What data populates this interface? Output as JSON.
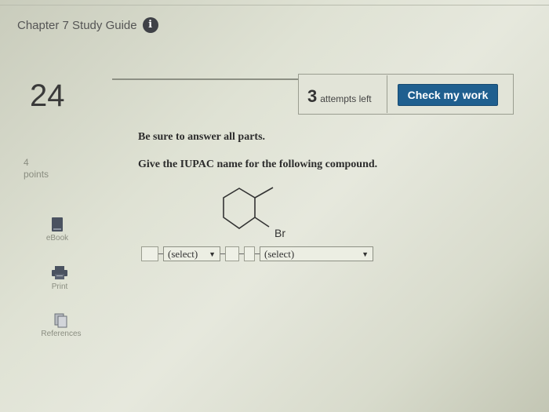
{
  "header": {
    "title": "Chapter 7 Study Guide",
    "info_icon": "info-icon"
  },
  "question_number": "24",
  "points": {
    "value": "4",
    "label": "points"
  },
  "toolbar": {
    "attempts_count": "3",
    "attempts_label": "attempts left",
    "check_button": "Check my work"
  },
  "sidebar": [
    {
      "label": "eBook",
      "icon": "ebook-icon"
    },
    {
      "label": "Print",
      "icon": "print-icon"
    },
    {
      "label": "References",
      "icon": "references-icon"
    }
  ],
  "content": {
    "instruction": "Be sure to answer all parts.",
    "question": "Give the IUPAC name for the following compound.",
    "substituent_label": "Br"
  },
  "answer": {
    "select1": "(select)",
    "select2": "(select)"
  }
}
